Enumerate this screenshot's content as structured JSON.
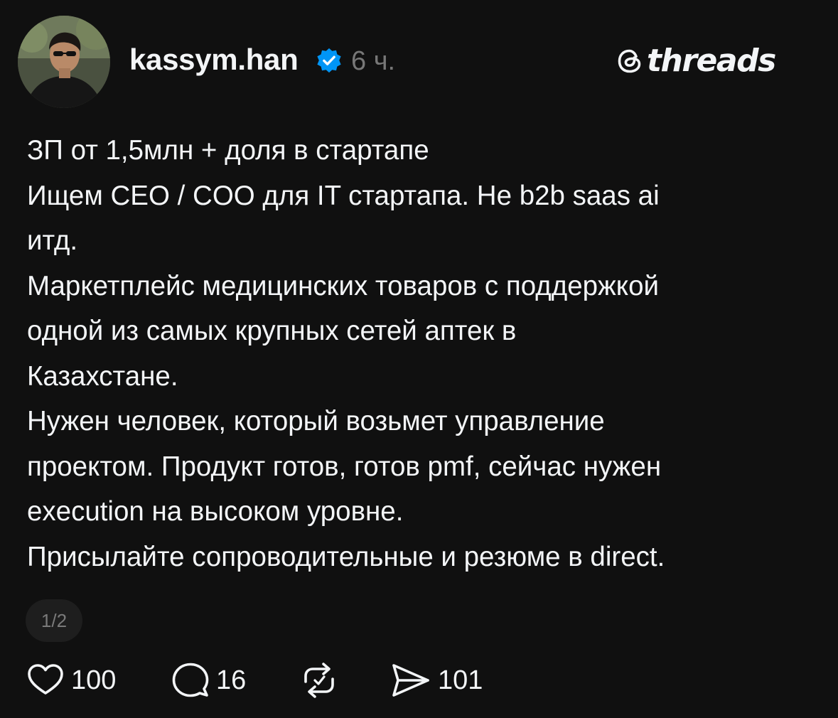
{
  "post": {
    "username": "kassym.han",
    "verified": true,
    "time": "6 ч.",
    "brand": "threads",
    "body_lines": [
      "ЗП от 1,5млн + доля в стартапе",
      "Ищем CEO / COO для IT стартапа. Не b2b saas ai",
      "итд.",
      "Маркетплейс медицинских товаров с поддержкой",
      "одной из самых крупных сетей аптек в",
      "Казахстане.",
      "Нужен человек, который возьмет управление",
      "проектом. Продукт готов, готов pmf, сейчас нужен",
      "execution на высоком уровне.",
      "Присылайте сопроводительные и резюме в direct."
    ],
    "page_indicator": "1/2",
    "actions": {
      "likes": "100",
      "comments": "16",
      "reposts": "",
      "shares": "101"
    }
  },
  "icons": {
    "verified": "verified-badge-icon",
    "brand": "threads-logo-icon",
    "like": "heart-icon",
    "comment": "comment-bubble-icon",
    "repost": "repost-icon",
    "share": "send-icon"
  },
  "colors": {
    "background": "#101010",
    "text": "#f3f5f7",
    "muted": "#777777",
    "verified": "#0095f6"
  }
}
